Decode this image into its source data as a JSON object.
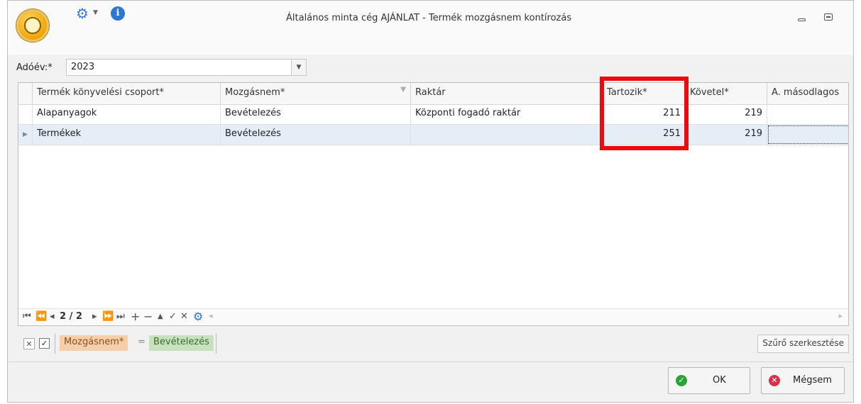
{
  "window": {
    "title": "Általános minta cég AJÁNLAT - Termék mozgásnem kontírozás",
    "icons": [
      "app-logo",
      "gear-icon",
      "info-icon",
      "minimize-icon",
      "maximize-icon"
    ],
    "info_glyph": "i"
  },
  "year": {
    "label": "Adóév:*",
    "value": "2023"
  },
  "grid": {
    "columns": [
      "Termék könyvelési csoport*",
      "Mozgásnem*",
      "Raktár",
      "Tartozik*",
      "Követel*",
      "A. másodlagos"
    ],
    "rows": [
      {
        "group": "Alapanyagok",
        "movement": "Bevételezés",
        "warehouse": "Központi fogadó raktár",
        "debit": "211",
        "credit": "219",
        "secondary": ""
      },
      {
        "group": "Termékek",
        "movement": "Bevételezés",
        "warehouse": "",
        "debit": "251",
        "credit": "219",
        "secondary": ""
      }
    ],
    "selected_row": 1
  },
  "navigator": {
    "page": "2 / 2"
  },
  "filter": {
    "field": "Mozgásnem*",
    "operator": "=",
    "value": "Bevételezés",
    "edit_label": "Szűrő szerkesztése",
    "enabled": true
  },
  "buttons": {
    "ok": "OK",
    "cancel": "Mégsem"
  },
  "colors": {
    "highlight": "#ee0a0a",
    "accent": "#2a77d4",
    "ok": "#2aa23a",
    "cancel": "#d9304a"
  }
}
